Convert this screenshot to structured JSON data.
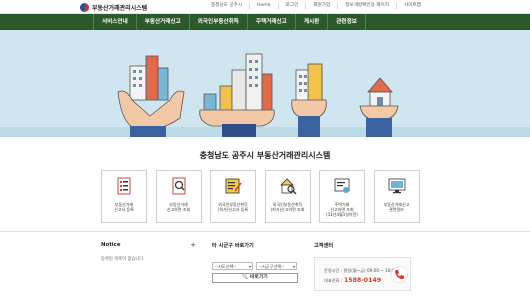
{
  "header": {
    "logo_text": "부동산거래관리시스템",
    "links": [
      "충청남도 공주시",
      "Home",
      "로그인",
      "회원가입",
      "정보개방확인용 재이지",
      "사이트맵"
    ]
  },
  "nav": {
    "items": [
      "서비스안내",
      "부동산거래신고",
      "외국인부동산취득",
      "주택거래신고",
      "게시판",
      "관련정보"
    ]
  },
  "main": {
    "title": "충청남도 공주시 부동산거래관리시스템",
    "services": [
      {
        "line1": "부동산거래",
        "line2": "신고서 등록",
        "line3": "",
        "icon": "document-list-icon"
      },
      {
        "line1": "부동산거래",
        "line2": "신고하면 조회",
        "line3": "",
        "icon": "document-search-icon"
      },
      {
        "line1": "외국인부동산취득",
        "line2": "(허가)신고서 등록",
        "line3": "",
        "icon": "document-edit-icon"
      },
      {
        "line1": "외국인부동산취득",
        "line2": "(허가)신고하면 조회",
        "line3": "",
        "icon": "house-search-icon"
      },
      {
        "line1": "주택거래",
        "line2": "신고하면 조회",
        "line3": "(11년4월1일이전)",
        "icon": "certificate-icon"
      },
      {
        "line1": "부동산거래신고",
        "line2": "관련정보",
        "line3": "",
        "icon": "monitor-icon"
      }
    ]
  },
  "notice": {
    "title": "Notice",
    "plus": "+",
    "empty_text": "등록된 목록이 없습니다."
  },
  "gsearch": {
    "title": "타 시군구 바로가기",
    "select1": "--시도선택--",
    "select2": "--시군구선택--",
    "button": "바로가기"
  },
  "center": {
    "title": "고객센터",
    "hours": "운영시간 : 평일(월~금) 09:00 ~ 18:00",
    "phone_label": "대표전화 :",
    "phone": "1588-0149"
  },
  "colors": {
    "nav": "#2d5a2b",
    "hero": "#cfe6f1",
    "phone": "#d8392b"
  }
}
